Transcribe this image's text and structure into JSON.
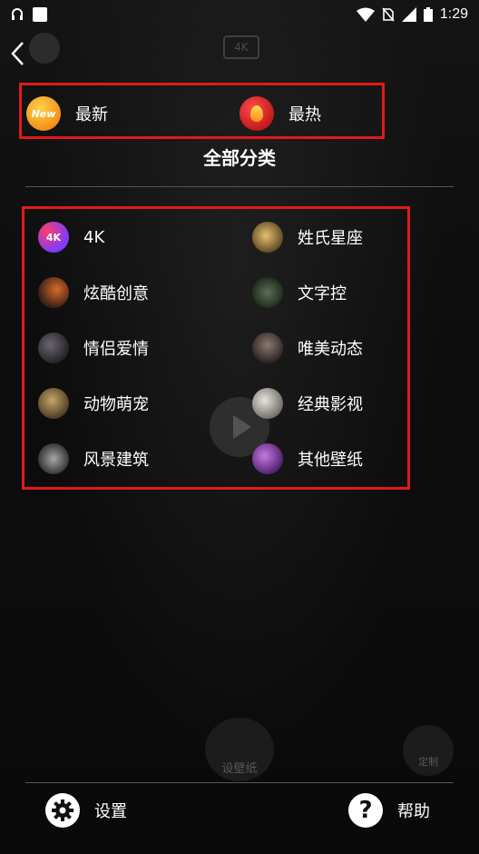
{
  "status_bar": {
    "time": "1:29",
    "icons": [
      "headset-icon",
      "square-notification-icon",
      "wifi-icon",
      "no-sim-icon",
      "signal-icon",
      "battery-icon"
    ]
  },
  "header": {
    "back_icon": "chevron-left-icon",
    "background_badge": "4K"
  },
  "top_tabs": [
    {
      "label": "最新",
      "icon": "new-badge-icon",
      "icon_text": "New"
    },
    {
      "label": "最热",
      "icon": "flame-icon"
    }
  ],
  "section_title": "全部分类",
  "categories": [
    {
      "label": "4K",
      "icon_text": "4K"
    },
    {
      "label": "姓氏星座"
    },
    {
      "label": "炫酷创意"
    },
    {
      "label": "文字控"
    },
    {
      "label": "情侣爱情"
    },
    {
      "label": "唯美动态"
    },
    {
      "label": "动物萌宠"
    },
    {
      "label": "经典影视"
    },
    {
      "label": "风景建筑"
    },
    {
      "label": "其他壁纸"
    }
  ],
  "background": {
    "set_wallpaper_label": "设壁纸",
    "custom_label": "定制"
  },
  "footer": {
    "settings_label": "设置",
    "help_label": "帮助",
    "help_symbol": "?"
  },
  "colors": {
    "highlight_border": "#e01a1a",
    "background": "#0b0b0b"
  }
}
